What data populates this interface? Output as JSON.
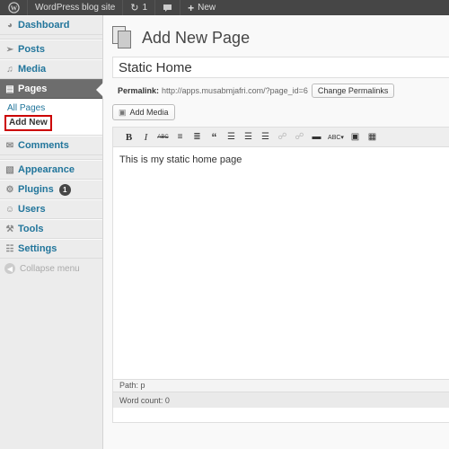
{
  "adminbar": {
    "site_name": "WordPress blog site",
    "updates_count": "1",
    "new_label": "New"
  },
  "sidebar": {
    "items": [
      {
        "label": "Dashboard",
        "icon": "dashboard-icon"
      },
      {
        "label": "Posts",
        "icon": "pushpin-icon"
      },
      {
        "label": "Media",
        "icon": "media-icon"
      },
      {
        "label": "Pages",
        "icon": "pages-icon",
        "active": true
      },
      {
        "label": "Comments",
        "icon": "comment-icon"
      },
      {
        "label": "Appearance",
        "icon": "appearance-icon"
      },
      {
        "label": "Plugins",
        "icon": "plugin-icon",
        "badge": "1"
      },
      {
        "label": "Users",
        "icon": "users-icon"
      },
      {
        "label": "Tools",
        "icon": "tools-icon"
      },
      {
        "label": "Settings",
        "icon": "settings-icon"
      }
    ],
    "pages_submenu": [
      "All Pages",
      "Add New"
    ],
    "collapse_label": "Collapse menu"
  },
  "main": {
    "page_title": "Add New Page",
    "post_title_value": "Static Home",
    "permalink_label": "Permalink:",
    "permalink_url": "http://apps.musabmjafri.com/?page_id=6",
    "change_permalinks_label": "Change Permalinks",
    "add_media_label": "Add Media",
    "editor_content": "This is my static home page",
    "path_text": "Path: p",
    "word_count_text": "Word count: 0"
  },
  "colors": {
    "adminbar_bg": "#464646",
    "link_blue": "#21759b",
    "active_menu_bg": "#6d6d6d",
    "highlight_border": "#cc0000"
  }
}
